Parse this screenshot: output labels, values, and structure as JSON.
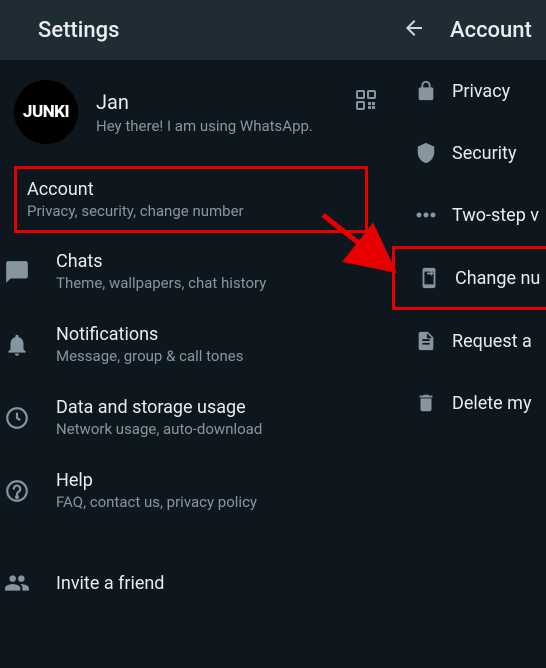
{
  "left": {
    "title": "Settings",
    "profile": {
      "avatar_text": "JUNKI",
      "name": "Jan",
      "status": "Hey there! I am using WhatsApp."
    },
    "items": [
      {
        "title": "Account",
        "sub": "Privacy, security, change number"
      },
      {
        "title": "Chats",
        "sub": "Theme, wallpapers, chat history"
      },
      {
        "title": "Notifications",
        "sub": "Message, group & call tones"
      },
      {
        "title": "Data and storage usage",
        "sub": "Network usage, auto-download"
      },
      {
        "title": "Help",
        "sub": "FAQ, contact us, privacy policy"
      },
      {
        "title": "Invite a friend",
        "sub": ""
      }
    ]
  },
  "right": {
    "title": "Account",
    "items": [
      {
        "label": "Privacy"
      },
      {
        "label": "Security"
      },
      {
        "label": "Two-step v"
      },
      {
        "label": "Change nu"
      },
      {
        "label": "Request a"
      },
      {
        "label": "Delete my"
      }
    ]
  }
}
